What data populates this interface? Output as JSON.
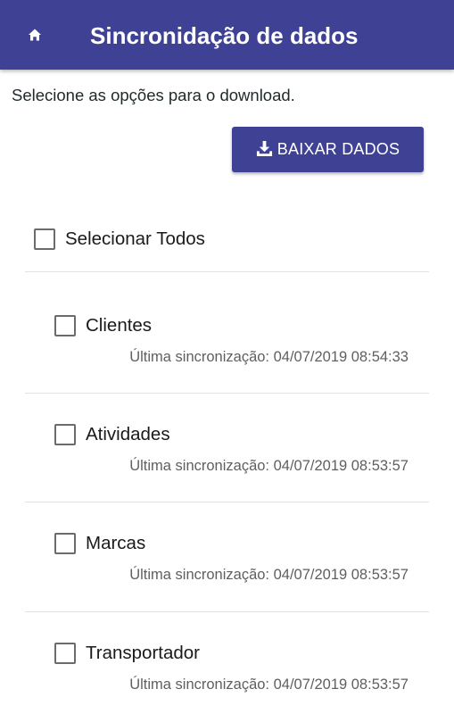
{
  "header": {
    "title": "Sincronidação de dados",
    "home_icon": "home-icon",
    "background_color": "#3f4194"
  },
  "instructions": "Selecione as opções para o download.",
  "download_button": {
    "label": "BAIXAR DADOS",
    "icon": "download-icon"
  },
  "select_all": {
    "label": "Selecionar Todos",
    "checked": false
  },
  "items": [
    {
      "label": "Clientes",
      "sync_text": "Última sincronização: 04/07/2019 08:54:33",
      "checked": false
    },
    {
      "label": "Atividades",
      "sync_text": "Última sincronização: 04/07/2019 08:53:57",
      "checked": false
    },
    {
      "label": "Marcas",
      "sync_text": "Última sincronização: 04/07/2019 08:53:57",
      "checked": false
    },
    {
      "label": "Transportador",
      "sync_text": "Última sincronização: 04/07/2019 08:53:57",
      "checked": false
    }
  ]
}
